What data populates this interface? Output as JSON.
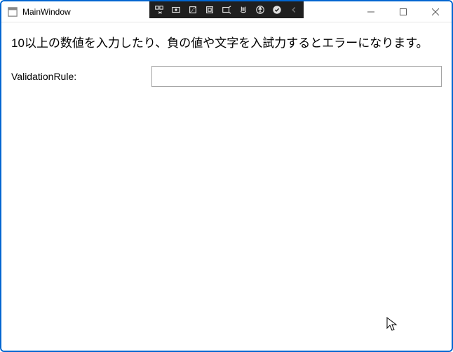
{
  "title": "MainWindow",
  "debug_toolbar": {
    "items": [
      "live-visual-tree-icon",
      "select-element-icon",
      "display-layout-adorners-icon",
      "track-focused-element-icon",
      "hot-reload-icon",
      "accessibility-icon",
      "go-to-live-visual-tree-icon",
      "checkmark-icon",
      "collapse-icon"
    ]
  },
  "window_controls": {
    "minimize": "—",
    "maximize": "▢",
    "close": "✕"
  },
  "content": {
    "instruction": "10以上の数値を入力したり、負の値や文字を入試力するとエラーになります。",
    "field_label": "ValidationRule:",
    "field_value": ""
  }
}
